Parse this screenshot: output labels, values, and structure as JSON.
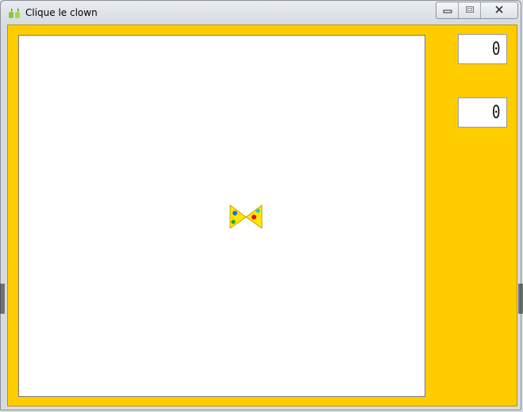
{
  "window": {
    "title": "Clique le clown",
    "app_icon": "app-icon",
    "caption": {
      "minimize": "minimize-icon",
      "maximize": "maximize-icon",
      "close": "close-icon"
    }
  },
  "game": {
    "counter_top": "0",
    "counter_bottom": "0",
    "target": "bowtie-clown"
  },
  "colors": {
    "background": "#ffcc00",
    "play_area": "#ffffff",
    "bowtie": "#ffe600",
    "dot_blue": "#1e73d8",
    "dot_green": "#2ca02c",
    "dot_red": "#e01010",
    "dot_cyan": "#20c8e8"
  }
}
